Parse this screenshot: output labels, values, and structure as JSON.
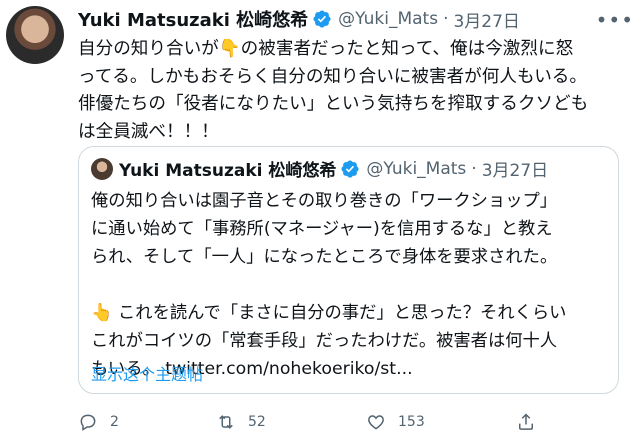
{
  "tweet": {
    "author_name": "Yuki Matsuzaki 松崎悠希",
    "handle": "@Yuki_Mats",
    "separator": "·",
    "date": "3月27日",
    "text_lines": [
      "自分の知り合いが👇の被害者だったと知って、俺は今激烈に怒",
      "ってる。しかもおそらく自分の知り合いに被害者が何人もいる。",
      "俳優たちの「役者になりたい」という気持ちを搾取するクソども",
      "は全員滅べ！！！"
    ]
  },
  "quoted_tweet": {
    "author_name": "Yuki Matsuzaki 松崎悠希",
    "handle": "@Yuki_Mats",
    "separator": "·",
    "date": "3月27日",
    "text_lines": [
      "俺の知り合いは園子音とその取り巻きの「ワークショップ」",
      "に通い始めて「事務所(マネージャー)を信用するな」と教え",
      "られ、そして「一人」になったところで身体を要求された。",
      "👆 これを読んで「まさに自分の事だ」と思った？それくらい",
      "これがコイツの「常套手段」だったわけだ。被害者は何十人",
      "もいる。 twitter.com/nohekoeriko/st..."
    ],
    "show_thread_label": "显示这个主题帖"
  },
  "actions": {
    "reply_count": "2",
    "retweet_count": "52",
    "like_count": "153"
  },
  "icons": {
    "verified": "verified-badge-icon",
    "more": "more-options-icon",
    "reply": "reply-icon",
    "retweet": "retweet-icon",
    "like": "heart-icon",
    "share": "share-icon"
  },
  "colors": {
    "accent": "#1d9bf0",
    "secondary_text": "#536471",
    "border": "#cfd9de"
  }
}
